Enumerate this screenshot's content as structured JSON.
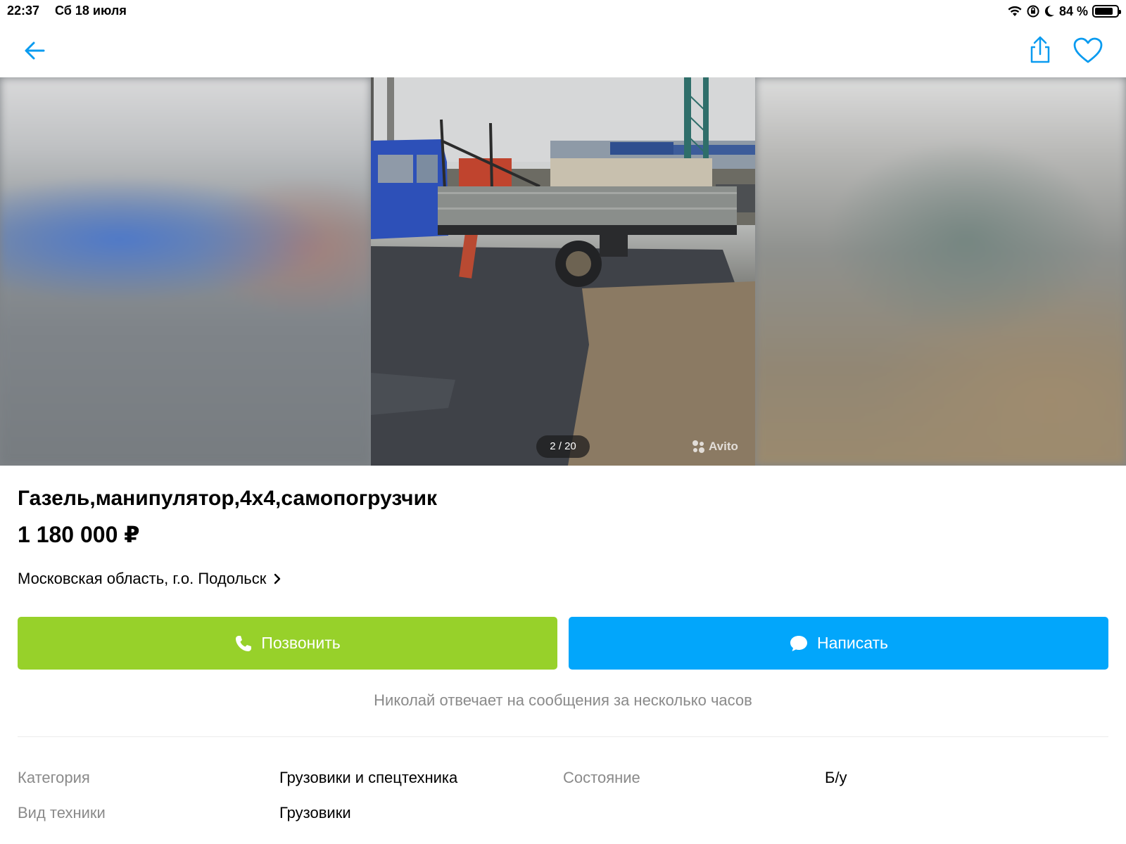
{
  "status_bar": {
    "time": "22:37",
    "date": "Сб 18 июля",
    "battery_pct": "84 %",
    "battery_level": 0.84
  },
  "nav": {
    "back_icon": "arrow-left-icon",
    "share_icon": "share-icon",
    "favorite_icon": "heart-icon",
    "accent_color": "#0a9bf0"
  },
  "gallery": {
    "counter": "2 / 20",
    "watermark": "Avito"
  },
  "listing": {
    "title": "Газель,манипулятор,4x4,самопогрузчик",
    "price": "1 180 000 ₽",
    "location": "Московская область, г.о. Подольск"
  },
  "actions": {
    "call_label": "Позвонить",
    "call_color": "#97d12a",
    "message_label": "Написать",
    "message_color": "#02a6fb"
  },
  "seller": {
    "reply_note": "Николай отвечает на сообщения за несколько часов"
  },
  "params": [
    {
      "label": "Категория",
      "value": "Грузовики и спецтехника"
    },
    {
      "label": "Состояние",
      "value": "Б/у"
    },
    {
      "label": "Вид техники",
      "value": "Грузовики"
    }
  ]
}
